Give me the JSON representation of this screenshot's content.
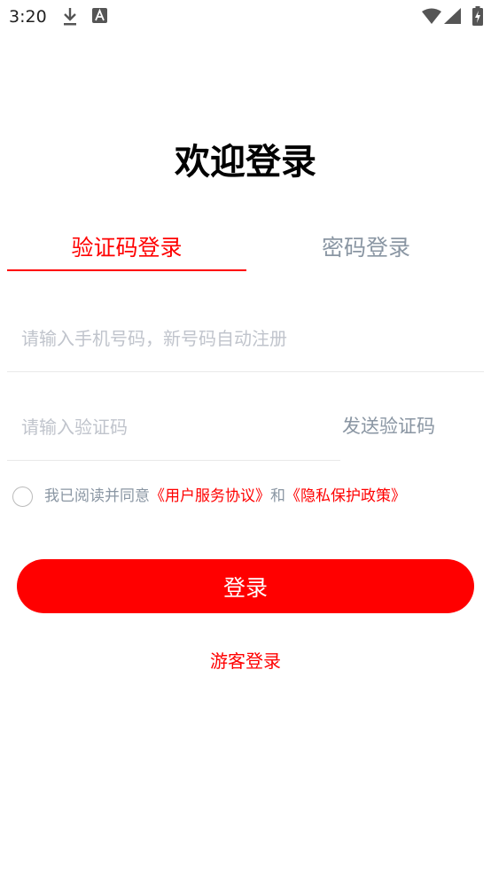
{
  "status_bar": {
    "time": "3:20",
    "icons": [
      "download-icon",
      "a-notification-icon",
      "wifi-icon",
      "signal-icon",
      "battery-charging-icon"
    ]
  },
  "title": "欢迎登录",
  "tabs": [
    {
      "label": "验证码登录",
      "active": true
    },
    {
      "label": "密码登录",
      "active": false
    }
  ],
  "phone_input": {
    "value": "",
    "placeholder": "请输入手机号码，新号码自动注册"
  },
  "code_input": {
    "value": "",
    "placeholder": "请输入验证码"
  },
  "send_code_label": "发送验证码",
  "agreement": {
    "prefix": "我已阅读并同意",
    "user_agreement": "《用户服务协议》",
    "conjunction": "和",
    "privacy_policy": "《隐私保护政策》",
    "checked": false
  },
  "login_button_label": "登录",
  "guest_login_label": "游客登录",
  "colors": {
    "accent": "#ff0000",
    "muted": "#8a96a3",
    "placeholder": "#c0c4cc",
    "divider": "#e9e9e9"
  }
}
